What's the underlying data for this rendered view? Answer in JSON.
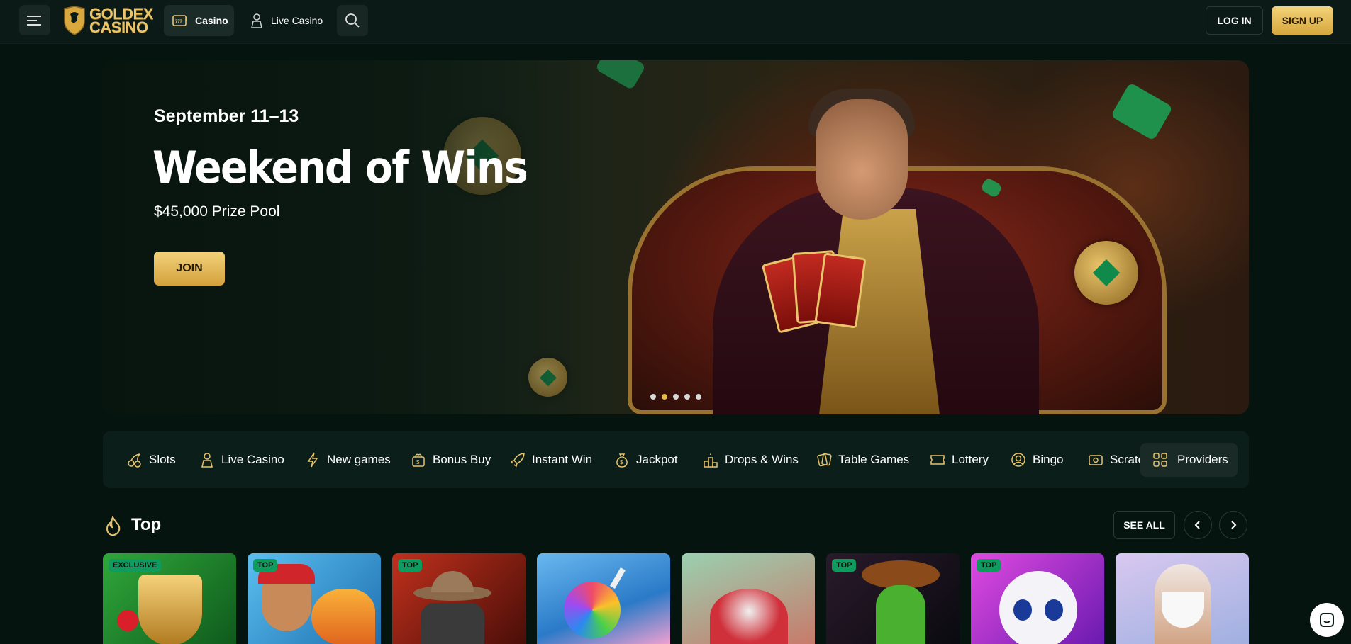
{
  "header": {
    "brand_line1": "GOLDEX",
    "brand_line2": "CASINO",
    "nav": [
      {
        "label": "Casino",
        "icon": "slot-machine-icon",
        "active": true
      },
      {
        "label": "Live Casino",
        "icon": "dealer-icon",
        "active": false
      }
    ],
    "login_label": "LOG IN",
    "signup_label": "SIGN UP"
  },
  "banner": {
    "date": "September 11–13",
    "title": "Weekend of Wins",
    "prize": "$45,000 Prize Pool",
    "cta": "JOIN",
    "slide_count": 5,
    "active_slide": 2
  },
  "categories": [
    {
      "label": "Slots",
      "icon": "cherries-icon"
    },
    {
      "label": "Live Casino",
      "icon": "dealer-icon"
    },
    {
      "label": "New games",
      "icon": "lightning-icon"
    },
    {
      "label": "Bonus Buy",
      "icon": "gift-bag-icon"
    },
    {
      "label": "Instant Win",
      "icon": "rocket-icon"
    },
    {
      "label": "Jackpot",
      "icon": "money-bag-icon"
    },
    {
      "label": "Drops & Wins",
      "icon": "podium-icon"
    },
    {
      "label": "Table Games",
      "icon": "cards-icon"
    },
    {
      "label": "Lottery",
      "icon": "ticket-icon"
    },
    {
      "label": "Bingo",
      "icon": "bingo-ball-icon"
    },
    {
      "label": "Scratch",
      "icon": "scratch-card-icon"
    }
  ],
  "providers_label": "Providers",
  "top_section": {
    "title": "Top",
    "see_all": "SEE ALL",
    "games": [
      {
        "badge": "EXCLUSIVE",
        "bg": "#1f7a2a"
      },
      {
        "badge": "TOP",
        "bg": "#3aa0e0"
      },
      {
        "badge": "TOP",
        "bg": "#8a1f14"
      },
      {
        "badge": "",
        "bg": "#4fa7e8"
      },
      {
        "badge": "",
        "bg": "#8ab9a0"
      },
      {
        "badge": "TOP",
        "bg": "#1a0e18"
      },
      {
        "badge": "TOP",
        "bg": "#c53ad0"
      },
      {
        "badge": "",
        "bg": "#b8a7d8"
      }
    ]
  },
  "colors": {
    "background": "#06140f",
    "gold": "#e9c46a",
    "badge_green": "#0f9a5e"
  }
}
